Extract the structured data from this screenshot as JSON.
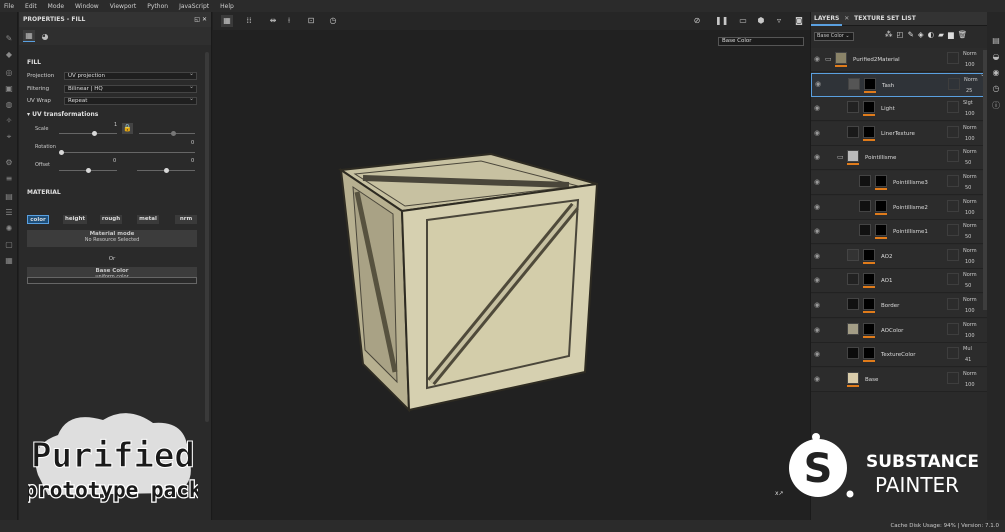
{
  "menu": [
    "File",
    "Edit",
    "Mode",
    "Window",
    "Viewport",
    "Python",
    "JavaScript",
    "Help"
  ],
  "properties": {
    "title": "PROPERTIES - FILL",
    "fill_section": "FILL",
    "projection_label": "Projection",
    "projection_value": "UV projection",
    "filtering_label": "Filtering",
    "filtering_value": "Bilinear | HQ",
    "uvwrap_label": "UV Wrap",
    "uvwrap_value": "Repeat",
    "uv_section": "UV transformations",
    "scale_label": "Scale",
    "scale_value": "1",
    "rotation_label": "Rotation",
    "rotation_value": "0",
    "offset_label": "Offset",
    "offset_x": "0",
    "offset_y": "0",
    "material_section": "MATERIAL",
    "channels": [
      "color",
      "height",
      "rough",
      "metal",
      "nrm"
    ],
    "material_mode_title": "Material mode",
    "material_mode_sub": "No Resource Selected",
    "or_label": "Or",
    "base_color_title": "Base Color",
    "base_color_sub": "uniform color"
  },
  "viewport": {
    "channel_dropdown": "Base Color"
  },
  "layers_panel": {
    "tab_layers": "LAYERS",
    "tab_texture_set": "TEXTURE SET LIST",
    "channel_dropdown": "Base Color",
    "items": [
      {
        "name": "Purified2Material",
        "blend": "Norm",
        "opacity": "100"
      },
      {
        "name": "Tash",
        "blend": "Norm",
        "opacity": "25"
      },
      {
        "name": "Light",
        "blend": "Slgt",
        "opacity": "100"
      },
      {
        "name": "LinerTexture",
        "blend": "Norm",
        "opacity": "100"
      },
      {
        "name": "Pointillisme",
        "blend": "Norm",
        "opacity": "50"
      },
      {
        "name": "Pointillisme3",
        "blend": "Norm",
        "opacity": "50"
      },
      {
        "name": "Pointillisme2",
        "blend": "Norm",
        "opacity": "100"
      },
      {
        "name": "Pointillisme1",
        "blend": "Norm",
        "opacity": "50"
      },
      {
        "name": "AO2",
        "blend": "Norm",
        "opacity": "100"
      },
      {
        "name": "AO1",
        "blend": "Norm",
        "opacity": "50"
      },
      {
        "name": "Border",
        "blend": "Norm",
        "opacity": "100"
      },
      {
        "name": "AOColor",
        "blend": "Norm",
        "opacity": "100"
      },
      {
        "name": "TextureColor",
        "blend": "Mul",
        "opacity": "41"
      },
      {
        "name": "Base",
        "blend": "Norm",
        "opacity": "100"
      }
    ]
  },
  "status": {
    "text": "Cache Disk Usage:   94% | Version: 7.1.0"
  },
  "branding": {
    "purified_line1": "Purified",
    "purified_line2": "prototype pack",
    "sp_line1": "SUBSTANCE",
    "sp_line2": "PAINTER"
  },
  "colors": {
    "accent": "#5aa0e0",
    "orange": "#e07b1a",
    "panel": "#2a2a2a"
  }
}
